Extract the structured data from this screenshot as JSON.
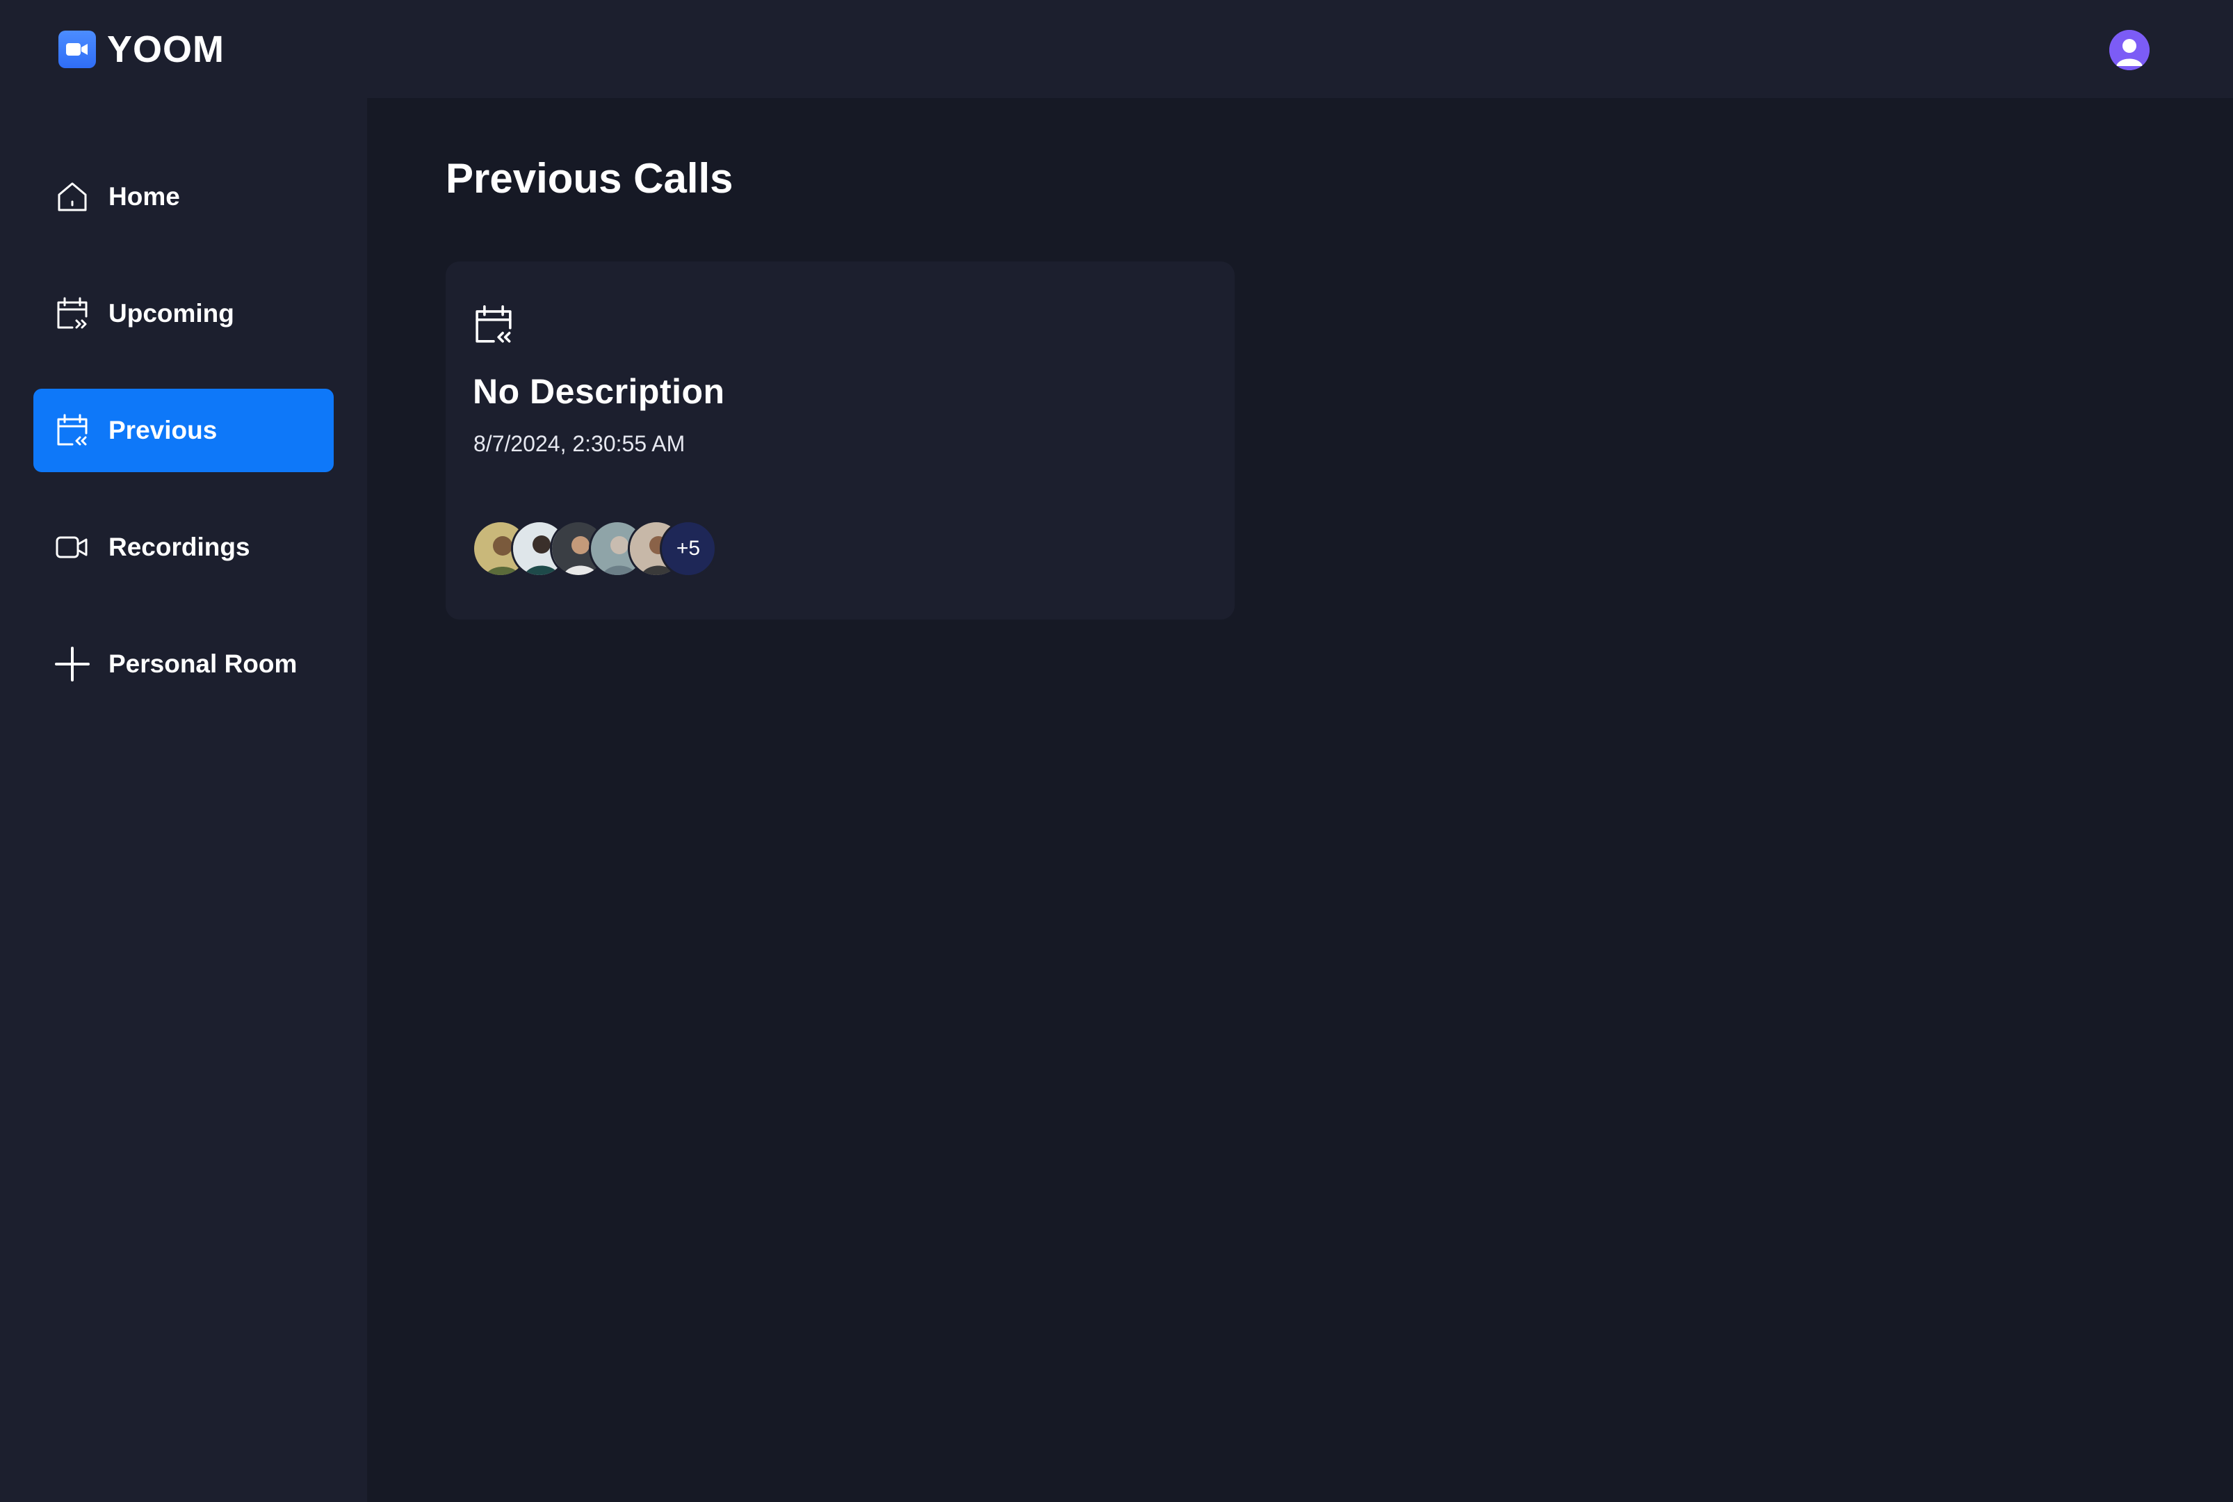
{
  "app": {
    "name": "YOOM",
    "brand_color": "#0e78f9",
    "logo_icon": "video-camera-icon"
  },
  "header": {
    "avatar_icon": "user-avatar-icon",
    "avatar_color": "#7c5cf6"
  },
  "sidebar": {
    "items": [
      {
        "label": "Home",
        "icon": "home-icon",
        "active": false
      },
      {
        "label": "Upcoming",
        "icon": "calendar-upcoming-icon",
        "active": false
      },
      {
        "label": "Previous",
        "icon": "calendar-previous-icon",
        "active": true
      },
      {
        "label": "Recordings",
        "icon": "video-icon",
        "active": false
      },
      {
        "label": "Personal Room",
        "icon": "plus-icon",
        "active": false
      }
    ]
  },
  "main": {
    "title": "Previous Calls",
    "calls": [
      {
        "icon": "calendar-previous-icon",
        "title": "No Description",
        "date": "8/7/2024, 2:30:55 AM",
        "more_attendees": "+5"
      }
    ]
  }
}
